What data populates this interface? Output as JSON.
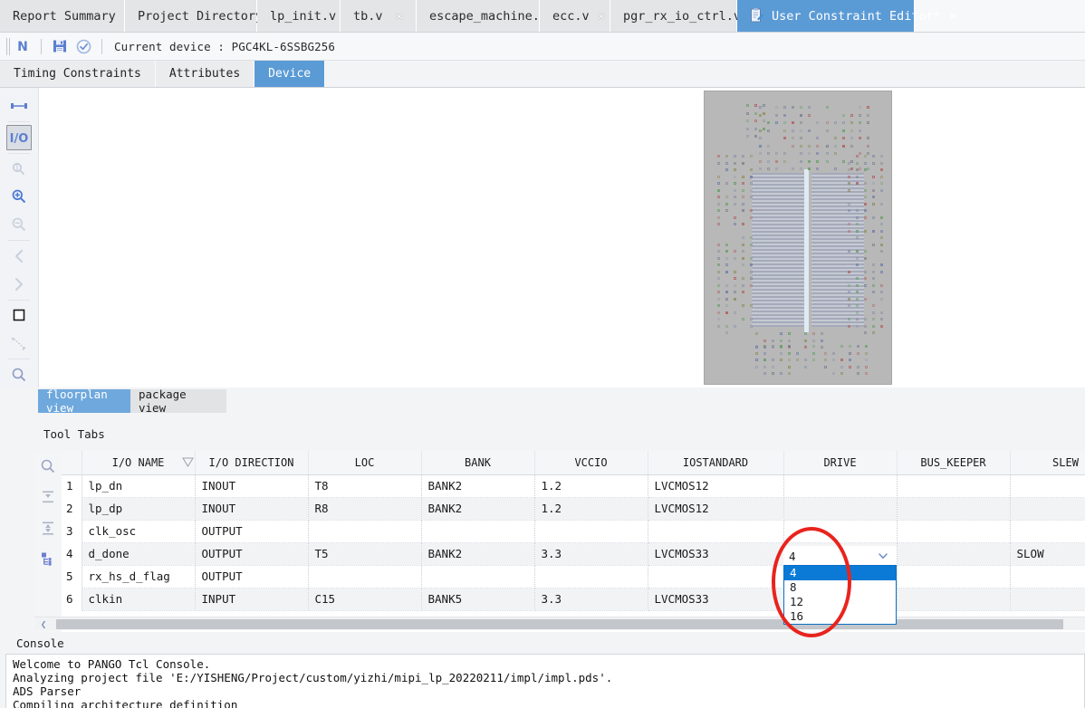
{
  "window": {
    "editor_tabs": [
      {
        "label": "Report Summary",
        "closable": false,
        "active": false,
        "icon": ""
      },
      {
        "label": "Project Directory",
        "closable": false,
        "active": false,
        "icon": ""
      },
      {
        "label": "lp_init.v",
        "closable": true,
        "active": false,
        "icon": ""
      },
      {
        "label": "tb.v",
        "closable": true,
        "active": false,
        "icon": ""
      },
      {
        "label": "escape_machine.v",
        "closable": true,
        "active": false,
        "icon": ""
      },
      {
        "label": "ecc.v",
        "closable": true,
        "active": false,
        "icon": ""
      },
      {
        "label": "pgr_rx_io_ctrl.v",
        "closable": true,
        "active": false,
        "icon": ""
      },
      {
        "label": "User Constraint Editor*",
        "closable": true,
        "active": true,
        "icon": "document-edit-icon"
      }
    ]
  },
  "device_toolbar": {
    "icons": [
      "new-constraint-icon",
      "save-icon",
      "check-icon"
    ],
    "device_label": "Current device : PGC4KL-6SSBG256"
  },
  "sub_tabs": [
    {
      "label": "Timing Constraints",
      "selected": false
    },
    {
      "label": "Attributes",
      "selected": false
    },
    {
      "label": "Device",
      "selected": true
    }
  ],
  "left_toolbar": {
    "items": [
      {
        "name": "fit-view-icon",
        "enabled": true,
        "framed": false
      },
      {
        "name": "io-ports-icon",
        "enabled": true,
        "framed": true,
        "label": "I/O"
      },
      {
        "name": "select-region-icon",
        "enabled": false,
        "framed": false
      },
      {
        "name": "zoom-in-icon",
        "enabled": true,
        "framed": false
      },
      {
        "name": "zoom-out-icon",
        "enabled": false,
        "framed": false
      },
      {
        "name": "previous-view-icon",
        "enabled": false,
        "framed": false
      },
      {
        "name": "next-view-icon",
        "enabled": false,
        "framed": false
      },
      {
        "name": "rectangle-select-icon",
        "enabled": true,
        "framed": false
      },
      {
        "name": "measure-distance-icon",
        "enabled": true,
        "framed": false
      },
      {
        "name": "search-icon",
        "enabled": true,
        "framed": false
      }
    ]
  },
  "view_tabs": [
    {
      "label": "floorplan view",
      "selected": true
    },
    {
      "label": "package view",
      "selected": false
    }
  ],
  "tool_tabs_label": "Tool Tabs",
  "table_side_icons": [
    "search-icon",
    "collapse-all-icon",
    "expand-all-icon",
    "hierarchy-icon"
  ],
  "io_table": {
    "columns": [
      "I/O NAME",
      "I/O DIRECTION",
      "LOC",
      "BANK",
      "VCCIO",
      "IOSTANDARD",
      "DRIVE",
      "BUS_KEEPER",
      "SLEW"
    ],
    "sorted_column": "I/O NAME",
    "rows": [
      {
        "num": "1",
        "io_name": "lp_dn",
        "direction": "INOUT",
        "loc": "T8",
        "bank": "BANK2",
        "vccio": "1.2",
        "iostandard": "LVCMOS12",
        "drive": "",
        "bus_keeper": "",
        "slew": ""
      },
      {
        "num": "2",
        "io_name": "lp_dp",
        "direction": "INOUT",
        "loc": "R8",
        "bank": "BANK2",
        "vccio": "1.2",
        "iostandard": "LVCMOS12",
        "drive": "",
        "bus_keeper": "",
        "slew": ""
      },
      {
        "num": "3",
        "io_name": "clk_osc",
        "direction": "OUTPUT",
        "loc": "",
        "bank": "",
        "vccio": "",
        "iostandard": "",
        "drive": "",
        "bus_keeper": "",
        "slew": ""
      },
      {
        "num": "4",
        "io_name": "d_done",
        "direction": "OUTPUT",
        "loc": "T5",
        "bank": "BANK2",
        "vccio": "3.3",
        "iostandard": "LVCMOS33",
        "drive": "",
        "bus_keeper": "",
        "slew": "SLOW"
      },
      {
        "num": "5",
        "io_name": "rx_hs_d_flag",
        "direction": "OUTPUT",
        "loc": "",
        "bank": "",
        "vccio": "",
        "iostandard": "",
        "drive": "",
        "bus_keeper": "",
        "slew": ""
      },
      {
        "num": "6",
        "io_name": "clkin",
        "direction": "INPUT",
        "loc": "C15",
        "bank": "BANK5",
        "vccio": "3.3",
        "iostandard": "LVCMOS33",
        "drive": "",
        "bus_keeper": "",
        "slew": ""
      }
    ]
  },
  "drive_dropdown": {
    "value": "4",
    "options": [
      "4",
      "8",
      "12",
      "16"
    ],
    "selected_option": "4",
    "highlight_color": "#0b7ad6",
    "border_color": "#0b6fc4"
  },
  "annotation": {
    "shape": "ellipse",
    "color": "#e8241d"
  },
  "console": {
    "title": "Console",
    "lines": [
      "Welcome to PANGO Tcl Console.",
      "Analyzing project file 'E:/YISHENG/Project/custom/yizhi/mipi_lp_20220211/impl/impl.pds'.",
      "ADS Parser",
      "Compiling architecture definition"
    ]
  },
  "colors": {
    "accent_blue": "#5b9bd5",
    "tab_selected_blue": "#6fa8dc",
    "annotation_red": "#e8241d",
    "dropdown_blue": "#0b7ad6"
  }
}
